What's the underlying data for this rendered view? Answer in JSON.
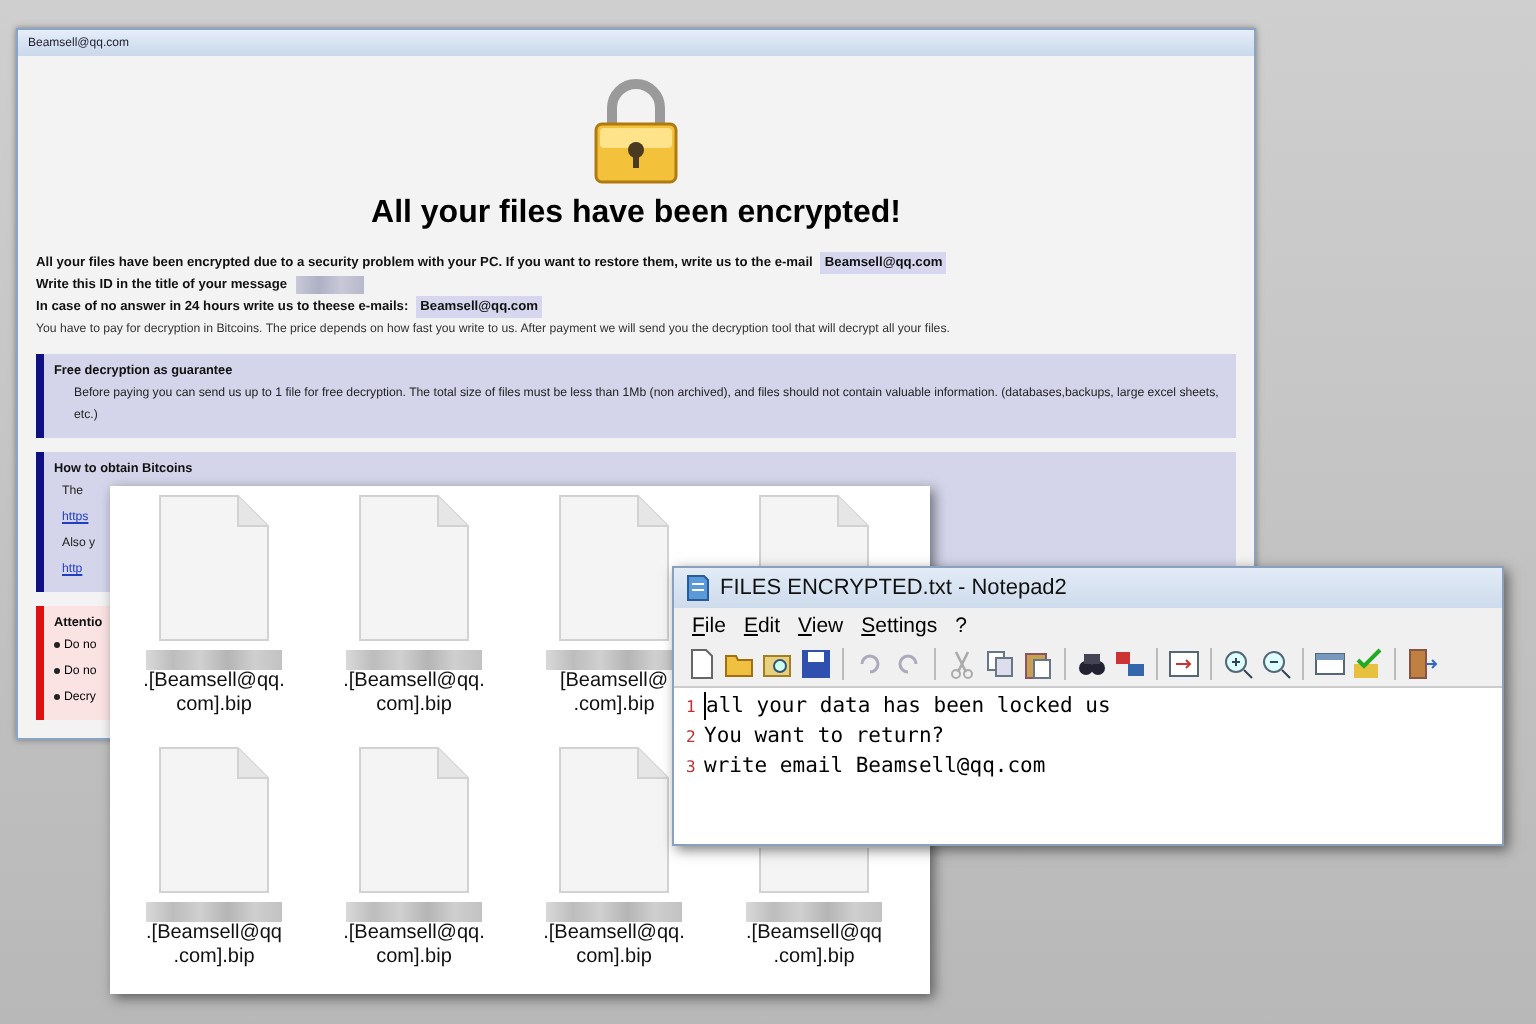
{
  "ransom_window": {
    "title": "Beamsell@qq.com",
    "heading": "All your files have been encrypted!",
    "lines": [
      {
        "text": "All your files have been encrypted due to a security problem with your PC. If you want to restore them, write us to the e-mail",
        "email": "Beamsell@qq.com",
        "bold": true,
        "kind": "text"
      },
      {
        "text": "Write this ID in the title of your message",
        "bold": true,
        "kind": "id"
      },
      {
        "text": "In case of no answer in 24 hours write us to theese e-mails:",
        "email": "Beamsell@qq.com",
        "bold": true,
        "kind": "text"
      },
      {
        "text": "You have to pay for decryption in Bitcoins. The price depends on how fast you write to us. After payment we will send you the decryption tool that will decrypt all your files.",
        "bold": false,
        "kind": "text"
      }
    ],
    "sections": [
      {
        "kind": "info",
        "title": "Free decryption as guarantee",
        "body": "Before paying you can send us up to 1 file for free decryption. The total size of files must be less than 1Mb (non archived), and files should not contain valuable information. (databases,backups, large excel sheets, etc.)"
      },
      {
        "kind": "info",
        "title": "How to obtain Bitcoins",
        "lines": [
          {
            "text": "The",
            "link": false
          },
          {
            "text": "https",
            "link": true
          },
          {
            "text": "Also y",
            "link": false
          },
          {
            "text": "http",
            "link": true
          }
        ]
      },
      {
        "kind": "warning",
        "title": "Attentio",
        "items": [
          "Do no",
          "Do no",
          "Decry"
        ]
      }
    ]
  },
  "file_pane": {
    "files": [
      {
        "kind": "file",
        "name_lines": [
          ".[Beamsell@qq.",
          "com].bip"
        ]
      },
      {
        "kind": "file",
        "name_lines": [
          ".[Beamsell@qq.",
          "com].bip"
        ]
      },
      {
        "kind": "file",
        "name_lines": [
          "[Beamsell@",
          ".com].bip"
        ]
      },
      {
        "kind": "file"
      },
      {
        "kind": "file",
        "name_lines": [
          ".[Beamsell@qq",
          ".com].bip"
        ]
      },
      {
        "kind": "file",
        "name_lines": [
          ".[Beamsell@qq.",
          "com].bip"
        ]
      },
      {
        "kind": "file",
        "name_lines": [
          ".[Beamsell@qq.",
          "com].bip"
        ]
      },
      {
        "kind": "file",
        "name_lines": [
          ".[Beamsell@qq",
          ".com].bip"
        ]
      }
    ]
  },
  "notepad": {
    "title": "FILES ENCRYPTED.txt - Notepad2",
    "menu": [
      "File",
      "Edit",
      "View",
      "Settings",
      "?"
    ],
    "lines": [
      {
        "number": "1",
        "text": "all your data has been locked us"
      },
      {
        "number": "2",
        "text": "You want to return?"
      },
      {
        "number": "3",
        "text": "write email Beamsell@qq.com"
      }
    ]
  }
}
